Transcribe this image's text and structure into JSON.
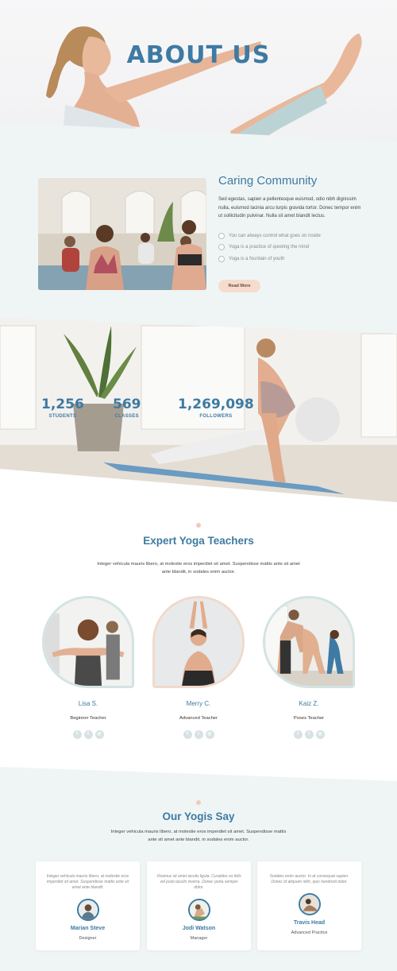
{
  "hero": {
    "title": "ABOUT US"
  },
  "community": {
    "title": "Caring Community",
    "description": "Sed egestas, sapien a pellentesque euismod, odio nibh dignissim nulla, euismod lacinia arcu turpis gravida tortor. Donec tempor enim ut sollicitudin pulvinar. Nulla sit amet blandit lectus.",
    "checklist": [
      "You can always control what goes on inside",
      "Yoga is a practice of quieting the mind",
      "Yoga is a fountain of youth"
    ],
    "button_label": "Read More"
  },
  "stats": [
    {
      "value": "1,256",
      "label": "STUDENTS"
    },
    {
      "value": "569",
      "label": "CLASSES"
    },
    {
      "value": "1,269,098",
      "label": "FOLLOWERS"
    }
  ],
  "teachers_section": {
    "title": "Expert Yoga Teachers",
    "description": "Integer vehicula mauris libero, at molestie eros imperdiet sit amet. Suspendisse mattis ante sit amet ante blandit, in sodales enim auctor.",
    "teachers": [
      {
        "name": "Lisa S.",
        "role": "Beginner Teacher"
      },
      {
        "name": "Merry C.",
        "role": "Advanced Teacher"
      },
      {
        "name": "Kaiz Z.",
        "role": "Poses Teacher"
      }
    ],
    "social_icons": [
      "facebook-icon",
      "twitter-icon",
      "instagram-icon"
    ]
  },
  "yogis_section": {
    "title": "Our Yogis Say",
    "description": "Integer vehicula mauris libero, at molestie eros imperdiet sit amet. Suspendisse mattis ante sit amet ante blandit, in sodales enim auctor.",
    "testimonials": [
      {
        "quote": "Integer vehicula mauris libero, at molestie eros imperdiet sit amet. Suspendisse mattis ante sit amet ante blandit.",
        "name": "Marian Steve",
        "role": "Designer"
      },
      {
        "quote": "Vivamus sit amet iaculis ligula. Curabitur ex felis vel justo iaculis viverra. Donec porta semper dolor.",
        "name": "Jodi Watson",
        "role": "Manager"
      },
      {
        "quote": "Sodales enim auctor. In at consequat sapien. Donec id aliquam nibh, quis hendrerit dolor.",
        "name": "Travis Head",
        "role": "Advanced Practice"
      }
    ]
  },
  "colors": {
    "accent": "#3e7aa3",
    "section_bg": "#eff5f5",
    "peach": "#f6dccf"
  }
}
